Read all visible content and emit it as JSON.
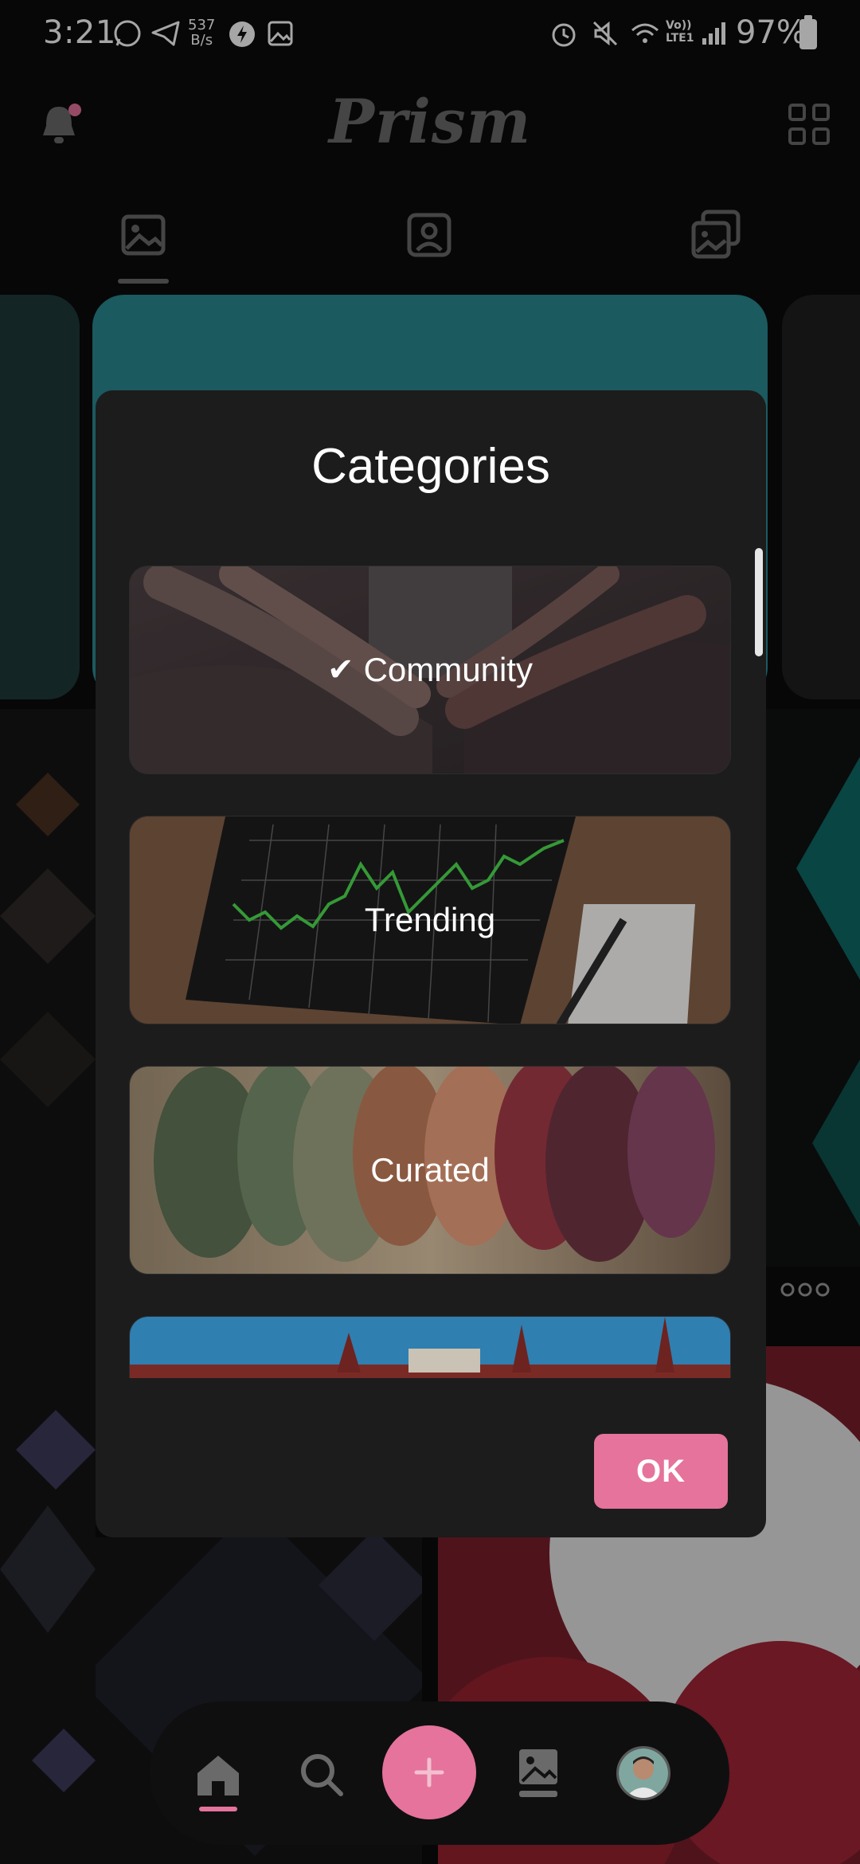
{
  "status_bar": {
    "time": "3:21",
    "net_speed_value": "537",
    "net_speed_unit": "B/s",
    "network_type": "Vo)) LTE1",
    "battery": "97%"
  },
  "header": {
    "app_title": "Prism"
  },
  "tabs": [
    "wallpapers-tab",
    "profile-tab",
    "collections-tab"
  ],
  "dialog": {
    "title": "Categories",
    "ok_label": "OK",
    "categories": [
      {
        "label": "Community",
        "selected": true
      },
      {
        "label": "Trending",
        "selected": false
      },
      {
        "label": "Curated",
        "selected": false
      }
    ]
  },
  "colors": {
    "accent": "#E5739B",
    "background": "#0B0B0C",
    "dialog": "#1C1C1D"
  }
}
